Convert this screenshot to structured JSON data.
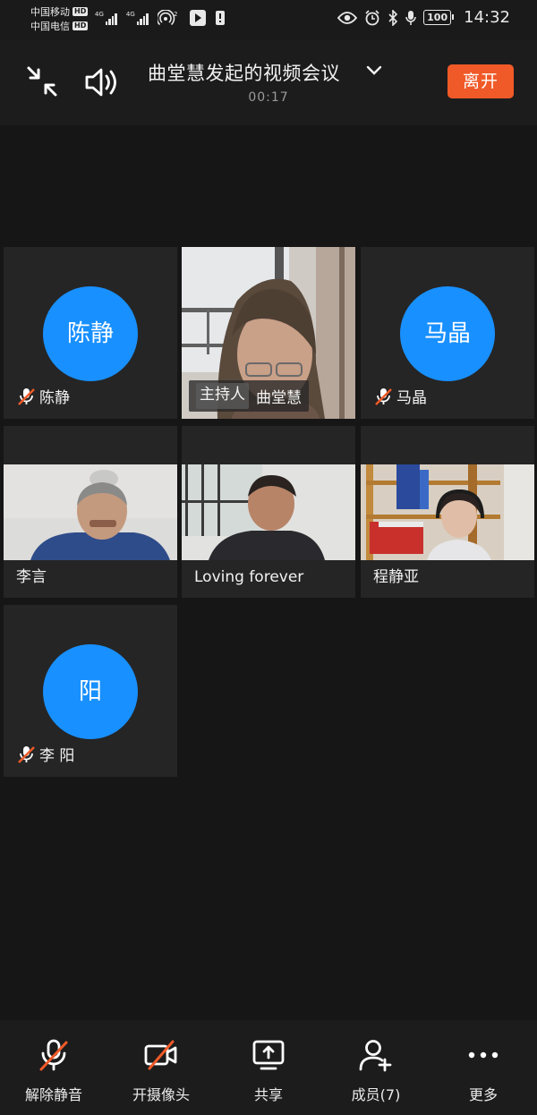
{
  "status_bar": {
    "carrier1": "中国移动",
    "carrier2": "中国电信",
    "hd": "HD",
    "network": "4G",
    "hotspot_count": "2",
    "battery": "100",
    "time": "14:32"
  },
  "header": {
    "title": "曲堂慧发起的视频会议",
    "timer": "00:17",
    "leave_label": "离开"
  },
  "participants": [
    {
      "name": "陈静",
      "avatar_text": "陈静",
      "muted": true
    },
    {
      "name": "曲堂慧",
      "host_tag": "主持人",
      "video": true
    },
    {
      "name": "马晶",
      "avatar_text": "马晶",
      "muted": true
    },
    {
      "name": "李言",
      "video": true
    },
    {
      "name": "Loving forever",
      "video": true
    },
    {
      "name": "程静亚",
      "video": true
    },
    {
      "name": "李 阳",
      "avatar_text": "阳",
      "muted": true
    }
  ],
  "toolbar": {
    "unmute": "解除静音",
    "camera": "开摄像头",
    "share": "共享",
    "members": "成员(7)",
    "more": "更多"
  },
  "colors": {
    "accent": "#1890ff",
    "leave": "#f05a28",
    "muted_slash": "#f05a28",
    "background": "#161616"
  }
}
